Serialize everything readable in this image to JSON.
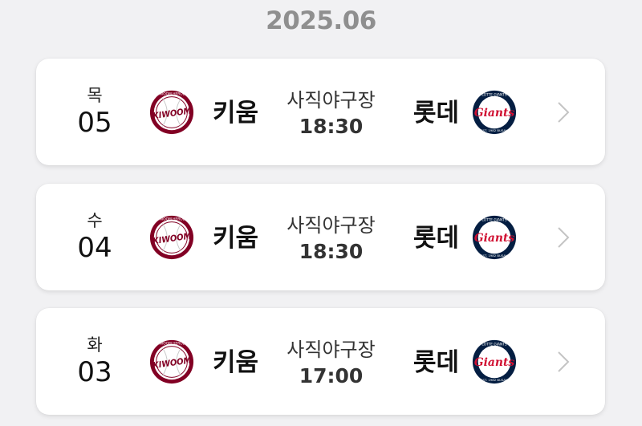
{
  "header": {
    "month": "2025.06"
  },
  "games": [
    {
      "dow": "목",
      "date": "05",
      "home_team": "키움",
      "away_team": "롯데",
      "venue": "사직야구장",
      "time": "18:30"
    },
    {
      "dow": "수",
      "date": "04",
      "home_team": "키움",
      "away_team": "롯데",
      "venue": "사직야구장",
      "time": "18:30"
    },
    {
      "dow": "화",
      "date": "03",
      "home_team": "키움",
      "away_team": "롯데",
      "venue": "사직야구장",
      "time": "17:00"
    }
  ],
  "logos": {
    "home_wordmark": "KIWOOM",
    "home_ring": "KIWOOM HEROES",
    "away_wordmark": "Giants",
    "away_ring": "LOTTE GIANTS",
    "away_bottom": "EST. 1982 BUSAN"
  },
  "colors": {
    "kiwoom_primary": "#820024",
    "giants_navy": "#041e42",
    "giants_red": "#d00f31",
    "chevron": "#c4c4c4"
  },
  "icons": {
    "home_logo": "kiwoom-heroes-logo",
    "away_logo": "lotte-giants-logo",
    "chevron": "chevron-right-icon"
  }
}
